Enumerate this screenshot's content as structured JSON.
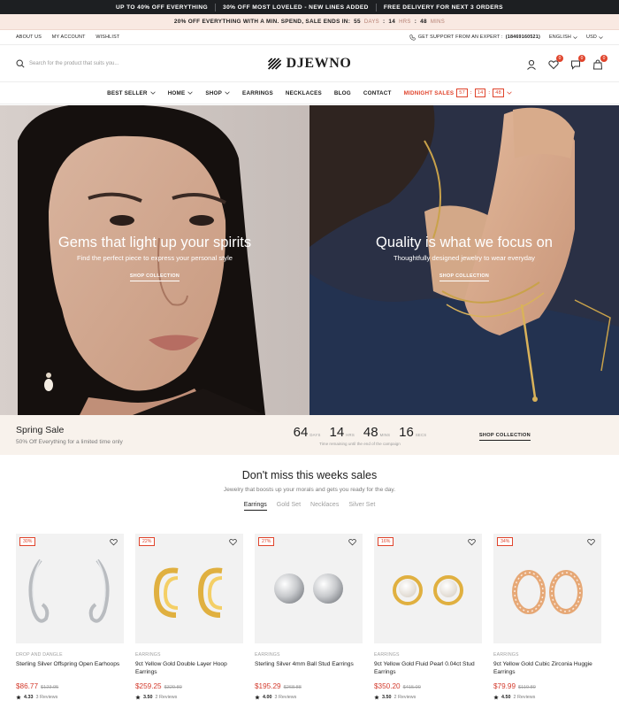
{
  "ticker": [
    "UP TO 40% OFF EVERYTHING",
    "30% OFF MOST LOVELED - NEW LINES ADDED",
    "FREE DELIVERY FOR NEXT 3 ORDERS"
  ],
  "promo": {
    "text": "20% OFF EVERYTHING WITH A MIN. SPEND, SALE ENDS IN:",
    "days": "55",
    "days_label": "DAYS",
    "hours": "14",
    "hours_label": "HRS",
    "mins": "48",
    "mins_label": "MINS"
  },
  "util": {
    "about": "ABOUT US",
    "account": "MY ACCOUNT",
    "wishlist": "WISHLIST",
    "support_label": "GET SUPPORT FROM AN EXPERT :",
    "phone": "(18469160521)",
    "language": "ENGLISH",
    "currency": "USD"
  },
  "header": {
    "search_placeholder": "Search for the product that suits you...",
    "logo": "DJEWNO",
    "wishlist_count": "0",
    "compare_count": "0",
    "cart_count": "0"
  },
  "nav": {
    "best_seller": "BEST SELLER",
    "home": "HOME",
    "shop": "SHOP",
    "earrings": "EARRINGS",
    "necklaces": "NECKLACES",
    "blog": "BLOG",
    "contact": "CONTACT",
    "midnight": "MIDNIGHT SALES",
    "t1": "57",
    "t2": "14",
    "t3": "48"
  },
  "hero": {
    "left": {
      "title": "Gems that light up your spirits",
      "sub": "Find the perfect piece to express your personal style",
      "cta": "SHOP COLLECTION"
    },
    "right": {
      "title": "Quality is what we focus on",
      "sub": "Thoughtfully designed jewelry to wear everyday",
      "cta": "SHOP COLLECTION"
    }
  },
  "sale": {
    "title": "Spring Sale",
    "sub": "50% Off Everything for a limited time only",
    "d": "64",
    "d_label": "DAYS",
    "h": "14",
    "h_label": "HRS",
    "m": "48",
    "m_label": "MINS",
    "s": "16",
    "s_label": "SECS",
    "caption": "Time remaining until the end of the campaign",
    "cta": "SHOP COLLECTION"
  },
  "section": {
    "title": "Don't miss this weeks sales",
    "sub": "Jewelry that boosts up your morals and gets you ready for the day.",
    "tabs": [
      "Earrings",
      "Gold Set",
      "Necklaces",
      "Silver Set"
    ]
  },
  "products": [
    {
      "discount": "30%",
      "category": "DROP AND DANGLE",
      "name": "Sterling Silver Offspring Open Earhoops",
      "price": "$86.77",
      "old": "$123.95",
      "rating": "4.33",
      "reviews": "3 Reviews"
    },
    {
      "discount": "22%",
      "category": "EARRINGS",
      "name": "9ct Yellow Gold Double Layer Hoop Earrings",
      "price": "$259.25",
      "old": "$329.89",
      "rating": "3.50",
      "reviews": "2 Reviews"
    },
    {
      "discount": "27%",
      "category": "EARRINGS",
      "name": "Sterling Silver 4mm Ball Stud Earrings",
      "price": "$195.29",
      "old": "$268.88",
      "rating": "4.00",
      "reviews": "3 Reviews"
    },
    {
      "discount": "16%",
      "category": "EARRINGS",
      "name": "9ct Yellow Gold Fluid Pearl 0.04ct Stud Earrings",
      "price": "$350.20",
      "old": "$415.00",
      "rating": "3.50",
      "reviews": "2 Reviews"
    },
    {
      "discount": "34%",
      "category": "EARRINGS",
      "name": "9ct Yellow Gold Cubic Zirconia Huggie Earrings",
      "price": "$79.99",
      "old": "$119.89",
      "rating": "4.50",
      "reviews": "2 Reviews"
    }
  ],
  "colors": {
    "accent": "#e0442c",
    "dark": "#1d1f22",
    "promo_bg": "#f9e9e2",
    "sale_bg": "#f8f2ec",
    "price": "#d33a2c"
  },
  "icons": [
    "search-icon",
    "user-icon",
    "heart-icon",
    "compare-icon",
    "bag-icon",
    "chevron-down-icon",
    "star-icon",
    "phone-icon"
  ]
}
